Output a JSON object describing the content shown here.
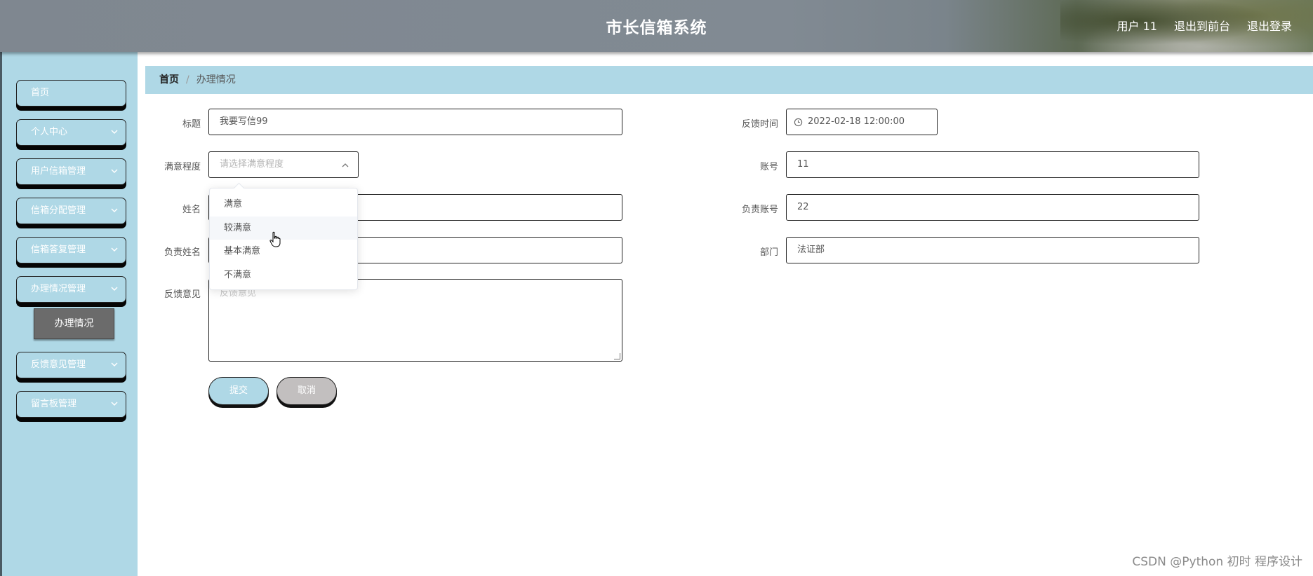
{
  "header": {
    "title": "市长信箱系统",
    "links": [
      "用户 11",
      "退出到前台",
      "退出登录"
    ]
  },
  "sidebar": {
    "items": [
      {
        "label": "首页",
        "icon": ""
      },
      {
        "label": "个人中心",
        "icon": "chevron-down-icon"
      },
      {
        "label": "用户信箱管理",
        "icon": "chevron-down-icon"
      },
      {
        "label": "信箱分配管理",
        "icon": "chevron-down-icon"
      },
      {
        "label": "信箱答复管理",
        "icon": "chevron-down-icon"
      },
      {
        "label": "办理情况管理",
        "icon": "chevron-down-icon"
      },
      {
        "label": "反馈意见管理",
        "icon": "chevron-down-icon"
      },
      {
        "label": "留言板管理",
        "icon": "chevron-down-icon"
      }
    ],
    "active_sub": "办理情况"
  },
  "breadcrumb": {
    "home": "首页",
    "current": "办理情况"
  },
  "form": {
    "title_label": "标题",
    "title_value": "我要写信99",
    "satisfaction_label": "满意程度",
    "satisfaction_placeholder": "请选择满意程度",
    "name_label": "姓名",
    "owner_name_label": "负责姓名",
    "feedback_label": "反馈意见",
    "feedback_placeholder": "反馈意见",
    "feedback_time_label": "反馈时间",
    "feedback_time_value": "2022-02-18 12:00:00",
    "account_label": "账号",
    "account_value": "11",
    "owner_account_label": "负责账号",
    "owner_account_value": "22",
    "dept_label": "部门",
    "dept_value": "法证部"
  },
  "dropdown": {
    "options": [
      "满意",
      "较满意",
      "基本满意",
      "不满意"
    ],
    "hovered": "较满意"
  },
  "buttons": {
    "submit": "提交",
    "cancel": "取消"
  },
  "watermark": "CSDN @Python 初时 程序设计",
  "colors": {
    "accent": "#afd8e6",
    "header": "#818a93",
    "active": "#6b6b6b"
  }
}
